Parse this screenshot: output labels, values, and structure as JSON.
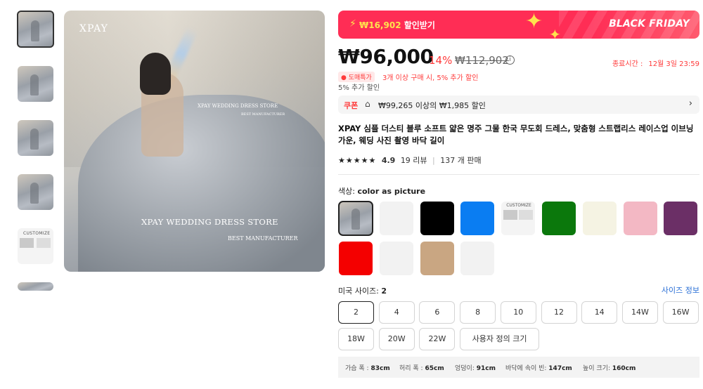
{
  "gallery": {
    "thumbnails": [
      {
        "name": "thumbnail-1",
        "kind": "photo"
      },
      {
        "name": "thumbnail-2",
        "kind": "photo"
      },
      {
        "name": "thumbnail-3",
        "kind": "photo"
      },
      {
        "name": "thumbnail-4",
        "kind": "photo"
      },
      {
        "name": "thumbnail-5",
        "kind": "customize",
        "label": "CUSTOMIZE"
      }
    ],
    "main_image": {
      "brand_top_left": "XPAY",
      "watermark_small": "XPAY WEDDING DRESS STORE",
      "watermark_small_sub": "BEST MANUFACTURER",
      "watermark_big": "XPAY WEDDING DRESS STORE",
      "watermark_big_sub": "BEST MANUFACTURER"
    }
  },
  "banner": {
    "bolt": "⚡",
    "coupon_amount": "₩16,902",
    "coupon_suffix": " 할인받기",
    "black_friday": "BLACK FRIDAY",
    "accent_color": "#ff2d55"
  },
  "price": {
    "current": "₩96,000",
    "discount": "14%",
    "original": "₩112,902",
    "info_icon": "ⓘ",
    "end_label": "종료시간 :",
    "end_value": "12월 3일 23:59"
  },
  "deal": {
    "tag": "도매특가",
    "text": "3개 이상 구매 시, 5% 추가 할인",
    "extra": "5% 추가 할인"
  },
  "coupon": {
    "label": "쿠폰",
    "tag_icon": "🏷",
    "text": "₩99,265 이상의 ₩1,985 할인",
    "chevron": "›"
  },
  "product": {
    "title": "XPAY 심플 더스티 블루 소프트 얇은 명주 그물 한국 무도회 드레스, 맞춤형 스트랩리스 레이스업 이브닝 가운, 웨딩 사진 촬영 바닥 길이",
    "stars": "★★★★★",
    "rating": "4.9",
    "reviews": "19 리뷰",
    "sep": "|",
    "sold": "137 개 판매"
  },
  "color": {
    "label": "색상: ",
    "value": "color as picture",
    "swatches": [
      {
        "type": "img",
        "selected": true
      },
      {
        "type": "color",
        "hex": "#f2f2f2"
      },
      {
        "type": "color",
        "hex": "#000000"
      },
      {
        "type": "color",
        "hex": "#0a7df2"
      },
      {
        "type": "cust"
      },
      {
        "type": "color",
        "hex": "#0b780c"
      },
      {
        "type": "color",
        "hex": "#f5f3e3"
      },
      {
        "type": "color",
        "hex": "#f3b8c4"
      },
      {
        "type": "color",
        "hex": "#6b2f66"
      },
      {
        "type": "color",
        "hex": "#f40000"
      },
      {
        "type": "color",
        "hex": "#f2f2f2"
      },
      {
        "type": "color",
        "hex": "#c9a682"
      },
      {
        "type": "color",
        "hex": "#f2f2f2"
      }
    ]
  },
  "size": {
    "label": "미국 사이즈: ",
    "value": "2",
    "guide": "사이즈 정보",
    "options": [
      "2",
      "4",
      "6",
      "8",
      "10",
      "12",
      "14",
      "14W",
      "16W",
      "18W",
      "20W",
      "22W",
      "사용자 정의 크기"
    ],
    "selected": "2"
  },
  "measurements": [
    {
      "label": "가슴 폭 : ",
      "value": "83cm"
    },
    {
      "label": "허리 폭 : ",
      "value": "65cm"
    },
    {
      "label": "엉덩이: ",
      "value": "91cm"
    },
    {
      "label": "바닥에 속이 빈: ",
      "value": "147cm"
    },
    {
      "label": "높이 크기: ",
      "value": "160cm"
    }
  ]
}
